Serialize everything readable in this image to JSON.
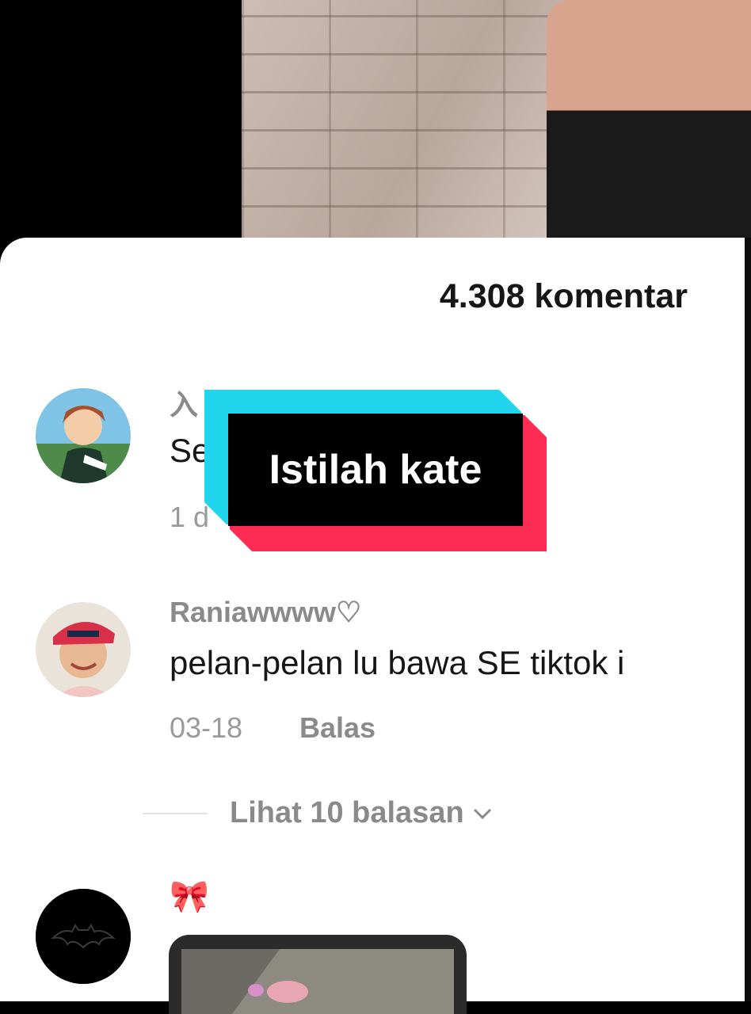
{
  "comments_header": {
    "count_label": "4.308 komentar"
  },
  "comments": [
    {
      "username": "入",
      "text": "Se",
      "meta": "1 d"
    },
    {
      "username": "Raniawwww♡",
      "text": "pelan-pelan lu bawa SE tiktok i",
      "meta": "03-18",
      "reply_label": "Balas",
      "view_replies": "Lihat 10 balasan"
    },
    {
      "username": "🎀"
    }
  ],
  "caption_overlay": {
    "text": "Istilah kate"
  },
  "colors": {
    "cyan": "#20d5ec",
    "red": "#fe2c55",
    "sheet": "#ffffff"
  }
}
